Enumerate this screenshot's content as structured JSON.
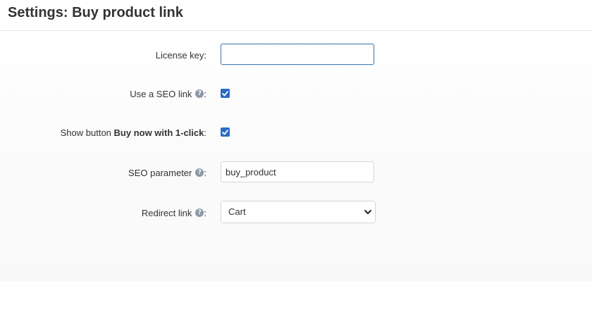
{
  "page": {
    "title": "Settings: Buy product link"
  },
  "form": {
    "license_key": {
      "label": "License key:",
      "value": "",
      "placeholder": ""
    },
    "use_seo_link": {
      "label": "Use a SEO link",
      "colon": ":",
      "checked": true,
      "help_icon": "question-circle-icon"
    },
    "show_button": {
      "label_prefix": "Show button ",
      "label_bold": "Buy now with 1-click",
      "colon": ":",
      "checked": true
    },
    "seo_parameter": {
      "label": "SEO parameter",
      "colon": ":",
      "value": "buy_product",
      "help_icon": "question-circle-icon"
    },
    "redirect_link": {
      "label": "Redirect link",
      "colon": ":",
      "selected": "Cart",
      "help_icon": "question-circle-icon"
    }
  },
  "colors": {
    "checkbox": "#2a6cc4",
    "focus_border": "#4a7fb5",
    "help_icon": "#8c99a6"
  }
}
